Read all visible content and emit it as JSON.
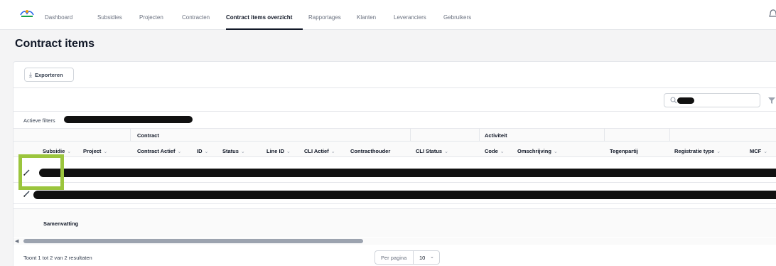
{
  "nav": {
    "items": [
      {
        "label": "Dashboard"
      },
      {
        "label": "Subsidies"
      },
      {
        "label": "Projecten"
      },
      {
        "label": "Contracten"
      },
      {
        "label": "Contract items overzicht"
      },
      {
        "label": "Rapportages"
      },
      {
        "label": "Klanten"
      },
      {
        "label": "Leveranciers"
      },
      {
        "label": "Gebruikers"
      }
    ],
    "active": "Contract items overzicht",
    "logo_icon": "logo-icon",
    "notification_icon": "bell-icon"
  },
  "page": {
    "title": "Contract items"
  },
  "toolbar": {
    "export_label": "Exporteren",
    "export_icon": "download-icon"
  },
  "search": {
    "placeholder": "",
    "icon": "search-icon",
    "filter_icon": "filter-icon"
  },
  "filters": {
    "label": "Actieve filters"
  },
  "table": {
    "groups": {
      "contract": "Contract",
      "activiteit": "Activiteit"
    },
    "columns": [
      {
        "label": "Subsidie",
        "sortable": true
      },
      {
        "label": "Project",
        "sortable": true
      },
      {
        "label": "Contract Actief",
        "sortable": true
      },
      {
        "label": "ID",
        "sortable": true
      },
      {
        "label": "Status",
        "sortable": true
      },
      {
        "label": "Line ID",
        "sortable": true
      },
      {
        "label": "CLI Actief",
        "sortable": true
      },
      {
        "label": "Contracthouder",
        "sortable": false
      },
      {
        "label": "CLI Status",
        "sortable": true
      },
      {
        "label": "Code",
        "sortable": true
      },
      {
        "label": "Omschrijving",
        "sortable": true
      },
      {
        "label": "Tegenpartij",
        "sortable": false
      },
      {
        "label": "Registratie type",
        "sortable": true
      },
      {
        "label": "MCF",
        "sortable": true
      }
    ],
    "rows": [
      {
        "edit_icon": "pencil-icon",
        "content": "redacted"
      },
      {
        "edit_icon": "pencil-icon",
        "content": "redacted"
      }
    ],
    "summary_label": "Samenvatting"
  },
  "footer": {
    "results": "Toont 1 tot 2 van 2 resultaten",
    "per_page_label": "Per pagina",
    "per_page_value": "10"
  },
  "colors": {
    "highlight": "#9bc53d",
    "redaction": "#111111"
  }
}
